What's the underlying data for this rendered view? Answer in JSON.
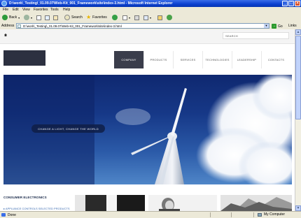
{
  "window": {
    "title": "file:///D:/work/_Testing/_01.09.07/Web-Kit_001_Framework/site/index-3.html - Microsoft Internet Explorer",
    "title_display": "D:\\work\\_Testing\\_01.09.07\\Web-Kit_001_Framework\\site\\index-3.html - Microsoft Internet Explorer",
    "controls": [
      "_",
      "□",
      "×"
    ]
  },
  "menubar": {
    "items": [
      "File",
      "Edit",
      "View",
      "Favorites",
      "Tools",
      "Help"
    ]
  },
  "toolbar": {
    "back_label": "Back",
    "search_label": "Search",
    "favorites_label": "Favorites"
  },
  "addressbar": {
    "label": "Address",
    "url": "D:\\work\\_Testing\\_01.09.07\\Web-Kit_001_Framework\\site\\index-3.html",
    "go_label": "Go",
    "links_label": "Links"
  },
  "page": {
    "search_label": "SEARCH",
    "nav": [
      {
        "label": "COMPANY",
        "active": true
      },
      {
        "label": "PRODUCTS",
        "active": false
      },
      {
        "label": "SERVICES",
        "active": false
      },
      {
        "label": "TECHNOLOGIES",
        "active": false
      },
      {
        "label": "LEADERSHIP",
        "active": false
      },
      {
        "label": "CONTACTS",
        "active": false
      }
    ],
    "hero_tagline": "CHANGE A LIGHT, CHANGE THE WORLD",
    "section_title": "CONSUMER ELECTRONICS",
    "section_link": "APPLIANCE CONTROLS SELECTED PRODUCTS"
  },
  "statusbar": {
    "status": "Done",
    "zone": "My Computer"
  },
  "colors": {
    "accent": "#3a3d4b",
    "hero_sky": "#163887",
    "titlebar": "#0a3fd0"
  }
}
